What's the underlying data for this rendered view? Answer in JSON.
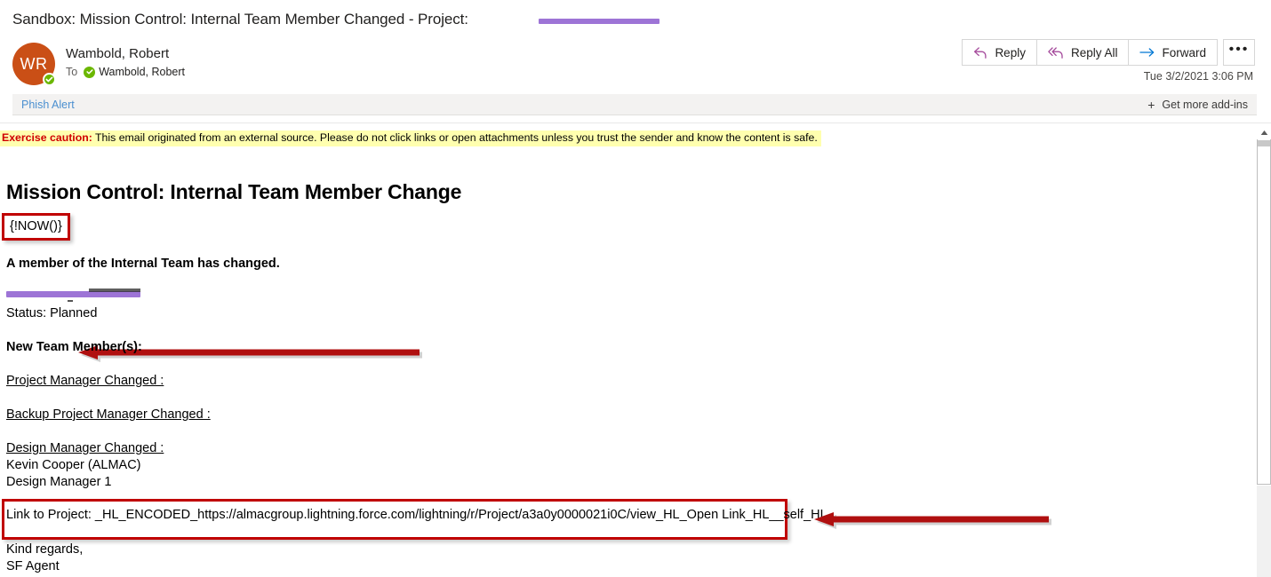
{
  "window": {
    "subject": "Sandbox: Mission Control: Internal Team Member Changed - Project:"
  },
  "sender": {
    "initials": "WR",
    "name": "Wambold, Robert",
    "to_label": "To",
    "recipient": "Wambold, Robert",
    "timestamp": "Tue 3/2/2021 3:06 PM"
  },
  "toolbar": {
    "reply_label": "Reply",
    "reply_all_label": "Reply All",
    "forward_label": "Forward",
    "more_label": "•••",
    "reply_icon": "reply-arrow-icon",
    "reply_all_icon": "reply-all-arrow-icon",
    "forward_icon": "forward-arrow-icon",
    "more_icon": "ellipsis-icon"
  },
  "addins": {
    "phish_alert_label": "Phish Alert",
    "get_more_label": "Get more add-ins",
    "plus_icon": "plus-icon"
  },
  "caution": {
    "lead": "Exercise caution:",
    "message": "This email originated from an external source. Please do not click links or open attachments unless you trust the sender and know the content is safe."
  },
  "body": {
    "title": "Mission Control: Internal Team Member Change",
    "now_token": "{!NOW()}",
    "summary": "A member of the Internal Team has changed.",
    "status": "Status: Planned",
    "new_members_heading": "New Team Member(s):",
    "project_manager_changed": "Project Manager Changed :",
    "backup_project_manager_changed": "Backup Project Manager Changed :",
    "design_manager_changed": "Design Manager Changed :",
    "design_manager_name": "Kevin Cooper (ALMAC)",
    "design_manager_role": "Design Manager 1",
    "link_line": "Link to Project: _HL_ENCODED_https://almacgroup.lightning.force.com/lightning/r/Project/a3a0y0000021i0C/view_HL_Open Link_HL__self_HL_",
    "sign_off": "Kind regards,",
    "sign_name": "SF Agent"
  },
  "annotations": {
    "arrow_now_icon": "red-left-arrow-icon",
    "arrow_link_icon": "red-left-arrow-icon",
    "redaction_icon": "purple-redaction-mark"
  },
  "scrollbar": {
    "up_arrow_icon": "scroll-up-arrow-icon",
    "thumb": "scroll-thumb"
  },
  "colors": {
    "accent_purple": "#9061d0",
    "avatar_orange": "#ca4f16",
    "presence_green": "#6bb700",
    "caution_yellow": "#ffffaf",
    "caution_red": "#d00000",
    "annotation_red": "#c00000",
    "reply_icon_purple": "#a4499b",
    "forward_icon_blue": "#0078d4",
    "link_blue": "#4a8fd0"
  }
}
